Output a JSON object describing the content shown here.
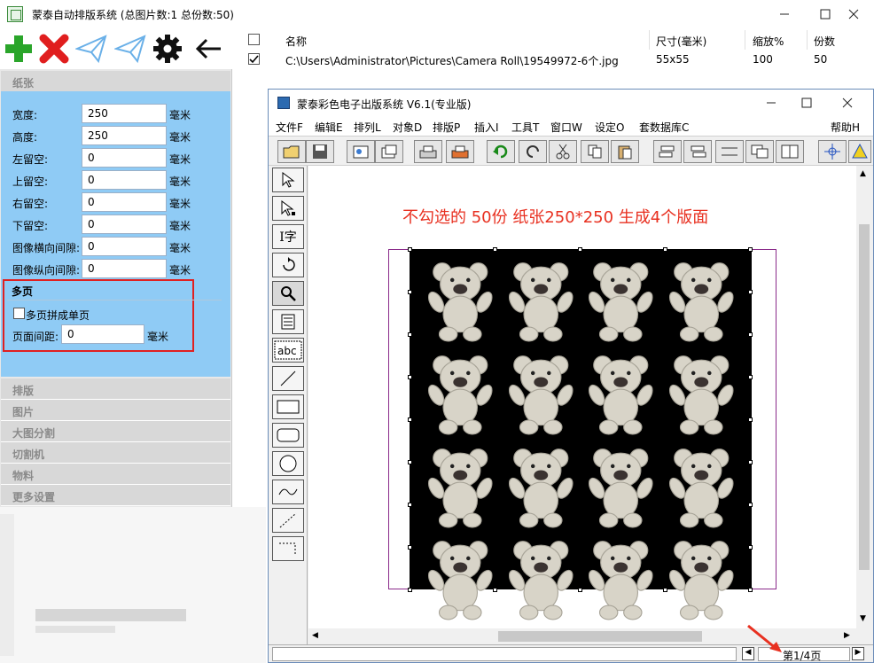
{
  "outer_window": {
    "title": "蒙泰自动排版系统 (总图片数:1 总份数:50)"
  },
  "left_panel": {
    "paper_section": "纸张",
    "fields": [
      {
        "label": "宽度:",
        "value": "250",
        "unit": "毫米"
      },
      {
        "label": "高度:",
        "value": "250",
        "unit": "毫米"
      },
      {
        "label": "左留空:",
        "value": "0",
        "unit": "毫米"
      },
      {
        "label": "上留空:",
        "value": "0",
        "unit": "毫米"
      },
      {
        "label": "右留空:",
        "value": "0",
        "unit": "毫米"
      },
      {
        "label": "下留空:",
        "value": "0",
        "unit": "毫米"
      },
      {
        "label": "图像横向间隙:",
        "value": "0",
        "unit": "毫米"
      },
      {
        "label": "图像纵向间隙:",
        "value": "0",
        "unit": "毫米"
      }
    ],
    "multipage": {
      "title": "多页",
      "checkbox_label": "多页拼成单页",
      "spacing_label": "页面间距:",
      "spacing_value": "0",
      "spacing_unit": "毫米"
    },
    "sections": [
      "排版",
      "图片",
      "大图分割",
      "切割机",
      "物料",
      "更多设置"
    ]
  },
  "file_list": {
    "headers": [
      "名称",
      "尺寸(毫米)",
      "缩放%",
      "份数"
    ],
    "rows": [
      {
        "checked": true,
        "name": "C:\\Users\\Administrator\\Pictures\\Camera Roll\\19549972-6个.jpg",
        "size": "55x55",
        "scale": "100",
        "copies": "50"
      }
    ]
  },
  "inner_window": {
    "title": "蒙泰彩色电子出版系统 V6.1(专业版)",
    "menu": [
      "文件F",
      "编辑E",
      "排列L",
      "对象D",
      "排版P",
      "插入I",
      "工具T",
      "窗口W",
      "设定O",
      "套数据库C"
    ],
    "menu_help": "帮助H",
    "annotation": "不勾选的  50份 纸张250*250 生成4个版面",
    "page_indicator": "第1/4页"
  },
  "colors": {
    "add": "#2aa52a",
    "delete": "#e01e1e",
    "panel_blue": "#8fcbf5",
    "annotation_red": "#e83020",
    "highlight_box": "#e02020"
  }
}
